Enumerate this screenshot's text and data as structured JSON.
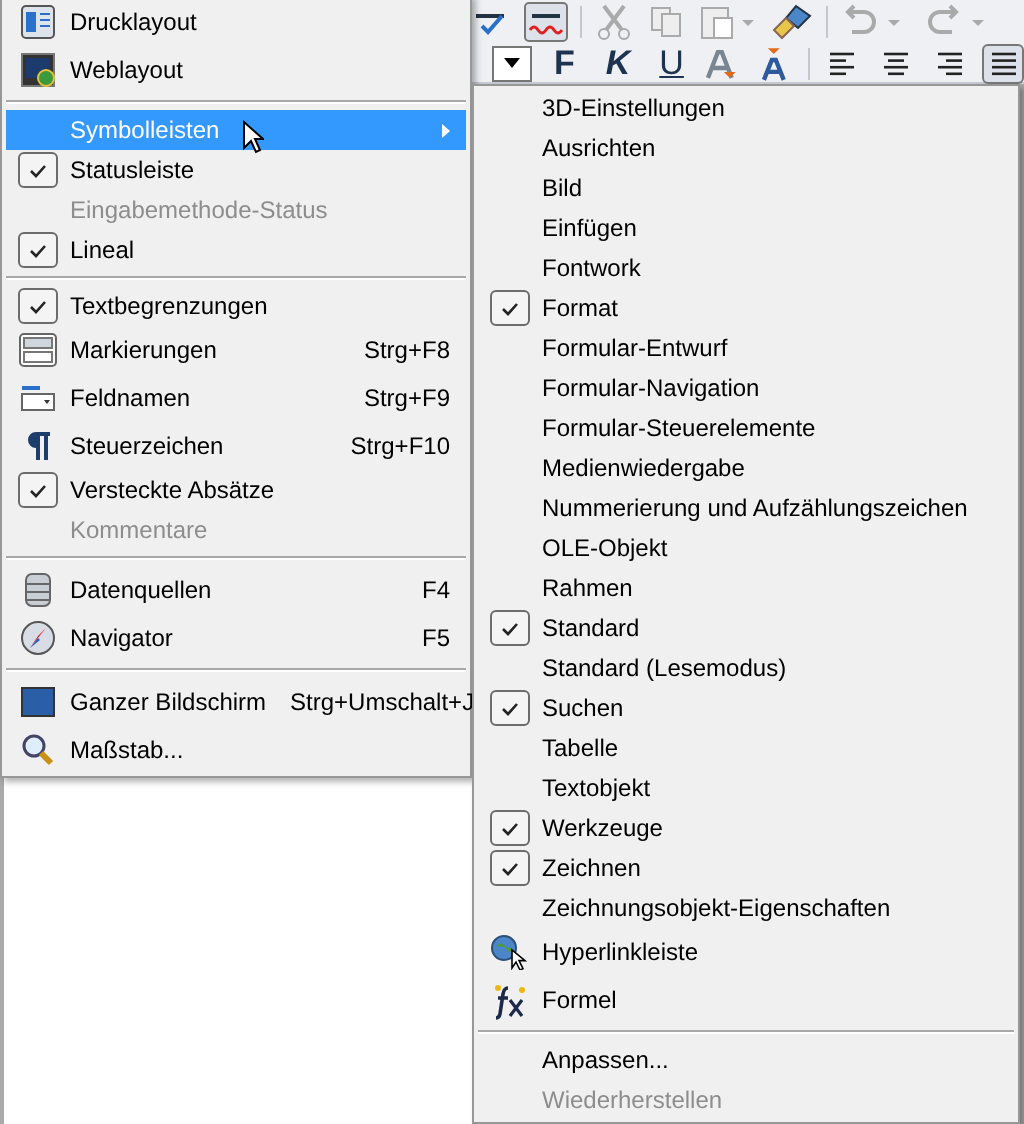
{
  "format_toolbar": {
    "text_buttons": [
      {
        "label": "F"
      },
      {
        "label": "K"
      },
      {
        "label": "U"
      }
    ],
    "align_buttons": [
      {
        "kind": "left",
        "selected": false
      },
      {
        "kind": "center",
        "selected": false
      },
      {
        "kind": "right",
        "selected": false
      },
      {
        "kind": "justify",
        "selected": true
      }
    ]
  },
  "view_menu": {
    "items": [
      {
        "kind": "printpage",
        "label": "Drucklayout",
        "checked": false,
        "disabled": false,
        "selected": false,
        "submenu": false
      },
      {
        "kind": "weblayout",
        "label": "Weblayout",
        "checked": false,
        "disabled": false,
        "selected": false,
        "submenu": false
      },
      {
        "kind": "separator"
      },
      {
        "kind": "check",
        "label": "Symbolleisten",
        "checked": false,
        "disabled": false,
        "selected": true,
        "submenu": true
      },
      {
        "kind": "check",
        "label": "Statusleiste",
        "checked": true,
        "disabled": false,
        "selected": false,
        "submenu": false
      },
      {
        "kind": "check",
        "label": "Eingabemethode-Status",
        "checked": false,
        "disabled": true,
        "selected": false,
        "submenu": false
      },
      {
        "kind": "check",
        "label": "Lineal",
        "checked": true,
        "disabled": false,
        "selected": false,
        "submenu": false
      },
      {
        "kind": "separator"
      },
      {
        "kind": "check",
        "label": "Textbegrenzungen",
        "checked": true,
        "disabled": false,
        "selected": false,
        "submenu": false
      },
      {
        "kind": "markings",
        "label": "Markierungen",
        "shortcut": "Strg+F8",
        "checked": false,
        "disabled": false,
        "selected": false,
        "submenu": false
      },
      {
        "kind": "fieldname",
        "label": "Feldnamen",
        "shortcut": "Strg+F9",
        "checked": false,
        "disabled": false,
        "selected": false,
        "submenu": false
      },
      {
        "kind": "pilcrow",
        "label": "Steuerzeichen",
        "shortcut": "Strg+F10",
        "checked": false,
        "disabled": false,
        "selected": false,
        "submenu": false
      },
      {
        "kind": "check",
        "label": "Versteckte Absätze",
        "checked": true,
        "disabled": false,
        "selected": false,
        "submenu": false
      },
      {
        "kind": "check",
        "label": "Kommentare",
        "checked": false,
        "disabled": true,
        "selected": false,
        "submenu": false
      },
      {
        "kind": "separator"
      },
      {
        "kind": "database",
        "label": "Datenquellen",
        "shortcut": "F4",
        "checked": false,
        "disabled": false,
        "selected": false,
        "submenu": false
      },
      {
        "kind": "compass",
        "label": "Navigator",
        "shortcut": "F5",
        "checked": false,
        "disabled": false,
        "selected": false,
        "submenu": false
      },
      {
        "kind": "separator"
      },
      {
        "kind": "screen",
        "label": "Ganzer Bildschirm",
        "shortcut": "Strg+Umschalt+J",
        "checked": false,
        "disabled": false,
        "selected": false,
        "submenu": false
      },
      {
        "kind": "magnifier",
        "label": "Maßstab...",
        "checked": false,
        "disabled": false,
        "selected": false,
        "submenu": false
      }
    ]
  },
  "toolbars_submenu": {
    "items": [
      {
        "kind": "check",
        "label": "3D-Einstellungen",
        "checked": false,
        "disabled": false
      },
      {
        "kind": "check",
        "label": "Ausrichten",
        "checked": false,
        "disabled": false
      },
      {
        "kind": "check",
        "label": "Bild",
        "checked": false,
        "disabled": false
      },
      {
        "kind": "check",
        "label": "Einfügen",
        "checked": false,
        "disabled": false
      },
      {
        "kind": "check",
        "label": "Fontwork",
        "checked": false,
        "disabled": false
      },
      {
        "kind": "check",
        "label": "Format",
        "checked": true,
        "disabled": false
      },
      {
        "kind": "check",
        "label": "Formular-Entwurf",
        "checked": false,
        "disabled": false
      },
      {
        "kind": "check",
        "label": "Formular-Navigation",
        "checked": false,
        "disabled": false
      },
      {
        "kind": "check",
        "label": "Formular-Steuerelemente",
        "checked": false,
        "disabled": false
      },
      {
        "kind": "check",
        "label": "Medienwiedergabe",
        "checked": false,
        "disabled": false
      },
      {
        "kind": "check",
        "label": "Nummerierung und Aufzählungszeichen",
        "checked": false,
        "disabled": false
      },
      {
        "kind": "check",
        "label": "OLE-Objekt",
        "checked": false,
        "disabled": false
      },
      {
        "kind": "check",
        "label": "Rahmen",
        "checked": false,
        "disabled": false
      },
      {
        "kind": "check",
        "label": "Standard",
        "checked": true,
        "disabled": false
      },
      {
        "kind": "check",
        "label": "Standard (Lesemodus)",
        "checked": false,
        "disabled": false
      },
      {
        "kind": "check",
        "label": "Suchen",
        "checked": true,
        "disabled": false
      },
      {
        "kind": "check",
        "label": "Tabelle",
        "checked": false,
        "disabled": false
      },
      {
        "kind": "check",
        "label": "Textobjekt",
        "checked": false,
        "disabled": false
      },
      {
        "kind": "check",
        "label": "Werkzeuge",
        "checked": true,
        "disabled": false
      },
      {
        "kind": "check",
        "label": "Zeichnen",
        "checked": true,
        "disabled": false
      },
      {
        "kind": "check",
        "label": "Zeichnungsobjekt-Eigenschaften",
        "checked": false,
        "disabled": false
      },
      {
        "kind": "globe",
        "label": "Hyperlinkleiste",
        "checked": false,
        "disabled": false
      },
      {
        "kind": "formula",
        "label": "Formel",
        "checked": false,
        "disabled": false
      },
      {
        "kind": "separator"
      },
      {
        "kind": "check",
        "label": "Anpassen...",
        "checked": false,
        "disabled": false
      },
      {
        "kind": "check",
        "label": "Wiederherstellen",
        "checked": false,
        "disabled": true
      }
    ]
  }
}
